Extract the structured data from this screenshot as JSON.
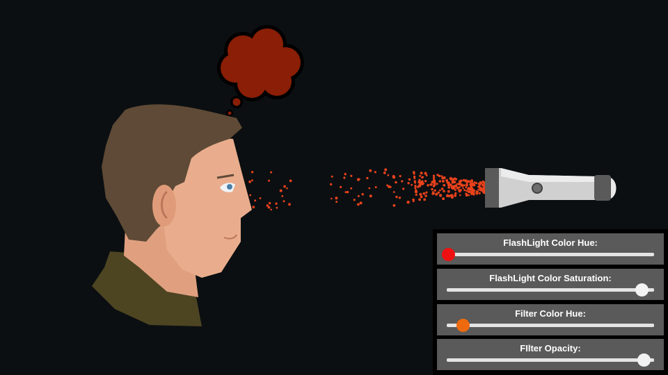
{
  "scene": {
    "thought_color": "#8b1e06",
    "particle_color": "#e8421c",
    "flashlight_body_color": "#d0d0d0",
    "flashlight_end_color": "#5a5a5a",
    "skin_color": "#e9ad8d",
    "hair_color": "#5e4a36",
    "shirt_color": "#4d4422"
  },
  "controls": [
    {
      "label": "FlashLight Color Hue:",
      "value": 0.01,
      "thumb_color": "#ee1111"
    },
    {
      "label": "FlashLight Color Saturation:",
      "value": 0.94,
      "thumb_color": "#f2f2f2"
    },
    {
      "label": "Filter Color Hue:",
      "value": 0.08,
      "thumb_color": "#ee6a0e"
    },
    {
      "label": "FIlter Opacity:",
      "value": 0.95,
      "thumb_color": "#f2f2f2"
    }
  ]
}
